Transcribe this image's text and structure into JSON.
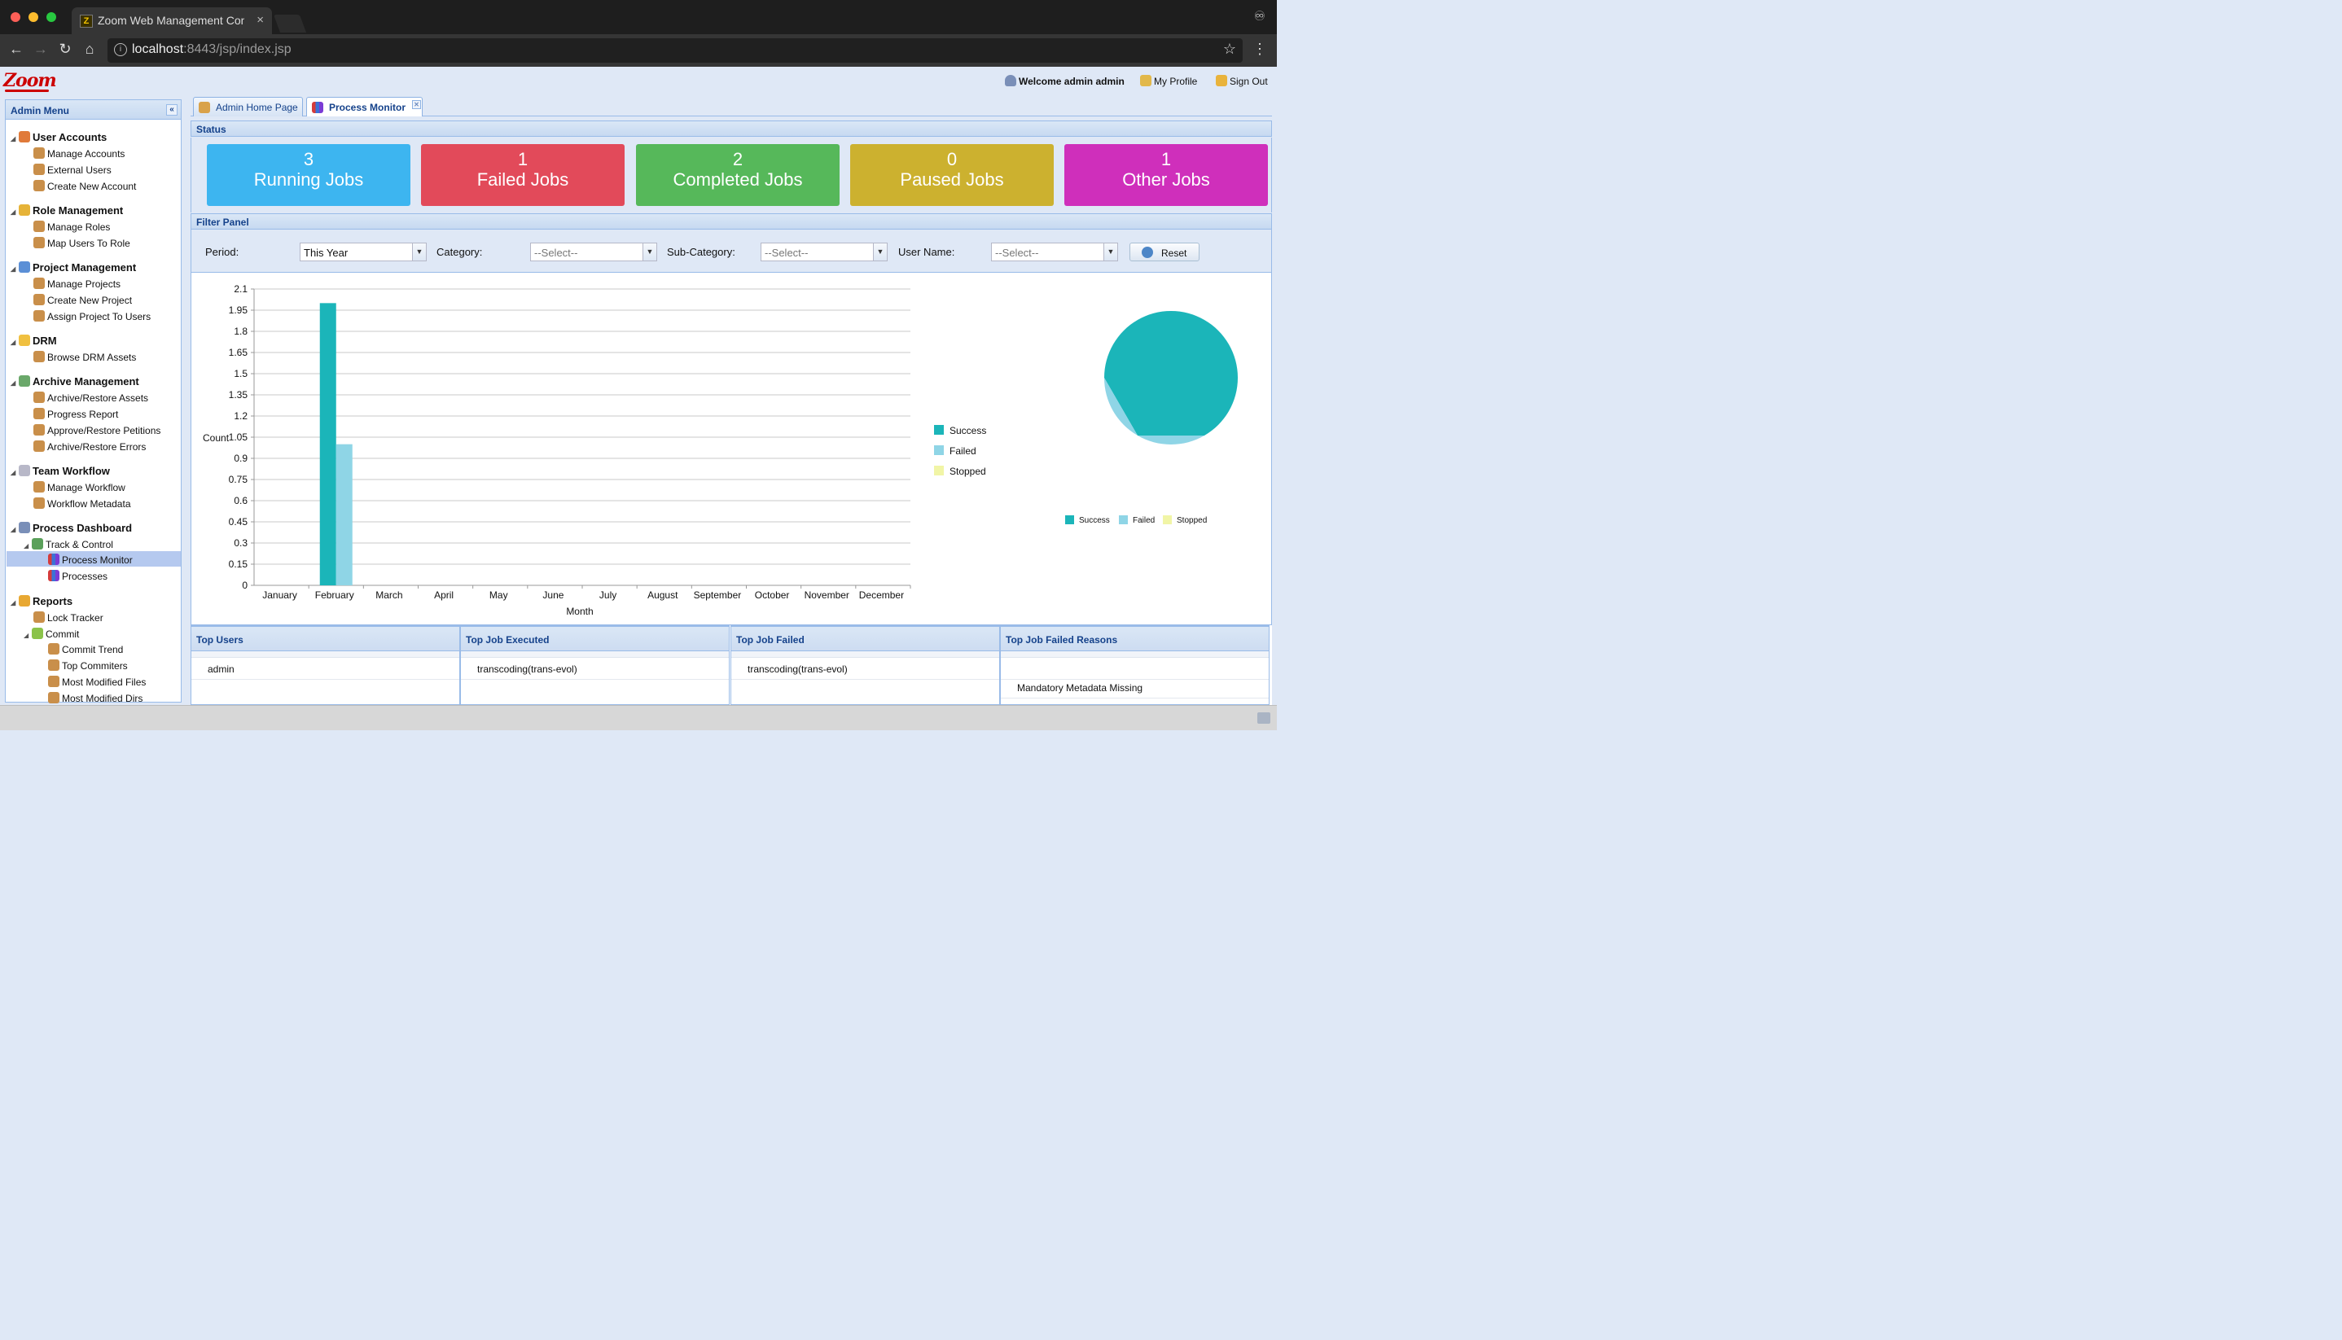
{
  "browser": {
    "tab_title": "Zoom Web Management Console",
    "url_host": "localhost",
    "url_rest": ":8443/jsp/index.jsp",
    "close_glyph": "×",
    "menu_glyph": "⋮",
    "star_glyph": "☆",
    "incognito_glyph": "♾"
  },
  "header": {
    "logo_text": "Zoom",
    "welcome": "Welcome admin admin",
    "my_profile": "My Profile",
    "sign_out": "Sign Out"
  },
  "admin_menu": {
    "title": "Admin Menu",
    "collapse_glyph": "«",
    "groups": [
      {
        "label": "User Accounts",
        "icon": "users-icon",
        "items": [
          "Manage Accounts",
          "External Users",
          "Create New Account"
        ]
      },
      {
        "label": "Role Management",
        "icon": "shield-icon",
        "items": [
          "Manage Roles",
          "Map Users To Role"
        ]
      },
      {
        "label": "Project Management",
        "icon": "globe-icon",
        "items": [
          "Manage Projects",
          "Create New Project",
          "Assign Project To Users"
        ]
      },
      {
        "label": "DRM",
        "icon": "folder-icon",
        "items": [
          "Browse DRM Assets"
        ]
      },
      {
        "label": "Archive Management",
        "icon": "archive-icon",
        "items": [
          "Archive/Restore Assets",
          "Progress Report",
          "Approve/Restore Petitions",
          "Archive/Restore Errors"
        ]
      },
      {
        "label": "Team Workflow",
        "icon": "workflow-icon",
        "items": [
          "Manage Workflow",
          "Workflow Metadata"
        ]
      },
      {
        "label": "Process Dashboard",
        "icon": "dashboard-icon",
        "sub": "Track & Control",
        "items": [
          "Process Monitor",
          "Processes"
        ]
      },
      {
        "label": "Reports",
        "icon": "reports-icon",
        "items": [
          "Lock Tracker"
        ],
        "sub": "Commit",
        "sub_items": [
          "Commit Trend",
          "Top Commiters",
          "Most Modified Files",
          "Most Modified Dirs"
        ]
      }
    ]
  },
  "tabs": [
    {
      "label": "Admin Home Page",
      "active": false
    },
    {
      "label": "Process Monitor",
      "active": true
    }
  ],
  "status": {
    "title": "Status",
    "cards": [
      {
        "count": "3",
        "label": "Running Jobs",
        "color": "#3db5f0"
      },
      {
        "count": "1",
        "label": "Failed Jobs",
        "color": "#e24a5a"
      },
      {
        "count": "2",
        "label": "Completed Jobs",
        "color": "#56b85a"
      },
      {
        "count": "0",
        "label": "Paused Jobs",
        "color": "#ccb12f"
      },
      {
        "count": "1",
        "label": "Other Jobs",
        "color": "#cf2fbb"
      }
    ]
  },
  "filter": {
    "title": "Filter Panel",
    "period_label": "Period:",
    "period_value": "This Year",
    "category_label": "Category:",
    "category_value": "--Select--",
    "subcategory_label": "Sub-Category:",
    "subcategory_value": "--Select--",
    "username_label": "User Name:",
    "username_value": "--Select--",
    "reset_label": "Reset"
  },
  "chart_data": [
    {
      "type": "bar",
      "xlabel": "Month",
      "ylabel": "Count",
      "ylim": [
        0,
        2.1
      ],
      "yticks": [
        "0",
        "0.15",
        "0.3",
        "0.45",
        "0.6",
        "0.75",
        "0.9",
        "1.05",
        "1.2",
        "1.35",
        "1.5",
        "1.65",
        "1.8",
        "1.95",
        "2.1"
      ],
      "categories": [
        "January",
        "February",
        "March",
        "April",
        "May",
        "June",
        "July",
        "August",
        "September",
        "October",
        "November",
        "December"
      ],
      "series": [
        {
          "name": "Success",
          "color": "#1bb5b9",
          "values": [
            0,
            2,
            0,
            0,
            0,
            0,
            0,
            0,
            0,
            0,
            0,
            0
          ]
        },
        {
          "name": "Failed",
          "color": "#8fd5e6",
          "values": [
            0,
            1,
            0,
            0,
            0,
            0,
            0,
            0,
            0,
            0,
            0,
            0
          ]
        },
        {
          "name": "Stopped",
          "color": "#f1f5a6",
          "values": [
            0,
            0,
            0,
            0,
            0,
            0,
            0,
            0,
            0,
            0,
            0,
            0
          ]
        }
      ],
      "legend": "right",
      "grid": true
    },
    {
      "type": "pie",
      "slices": [
        {
          "name": "Success",
          "value": 2,
          "color": "#1bb5b9"
        },
        {
          "name": "Failed",
          "value": 1,
          "color": "#8fd5e6"
        },
        {
          "name": "Stopped",
          "value": 0,
          "color": "#f1f5a6"
        }
      ],
      "legend": "bottom"
    }
  ],
  "grids": [
    {
      "title": "Top Users",
      "rows": [
        "admin"
      ]
    },
    {
      "title": "Top Job Executed",
      "rows": [
        "transcoding(trans-evol)"
      ]
    },
    {
      "title": "Top Job Failed",
      "rows": [
        "transcoding(trans-evol)"
      ]
    },
    {
      "title": "Top Job Failed Reasons",
      "rows": [
        "",
        "Mandatory Metadata Missing"
      ]
    }
  ]
}
